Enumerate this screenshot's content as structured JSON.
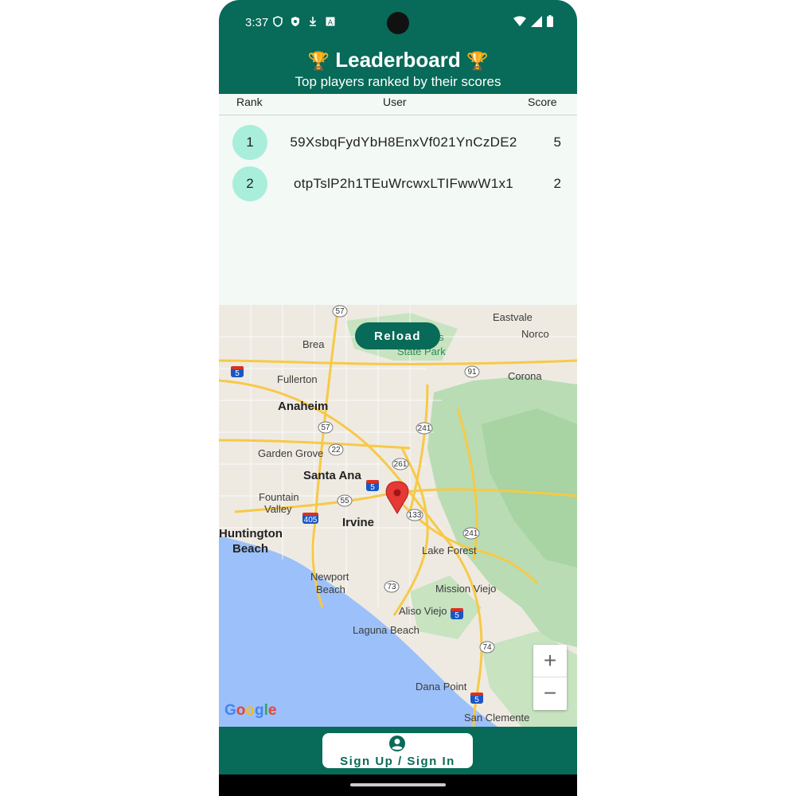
{
  "status_bar": {
    "time": "3:37"
  },
  "header": {
    "trophy_left": "🏆",
    "title": "Leaderboard",
    "trophy_right": "🏆",
    "subtitle": "Top players ranked by their scores"
  },
  "table": {
    "columns": {
      "rank": "Rank",
      "user": "User",
      "score": "Score"
    },
    "rows": [
      {
        "rank": "1",
        "user": "59XsbqFydYbH8EnxVf021YnCzDE2",
        "score": "5"
      },
      {
        "rank": "2",
        "user": "otpTslP2h1TEuWrcwxLTIFwwW1x1",
        "score": "2"
      }
    ]
  },
  "map": {
    "reload_label": "Reload",
    "zoom_in": "+",
    "zoom_out": "−",
    "attribution": "Google",
    "labels": {
      "eastvale": "Eastvale",
      "norco": "Norco",
      "brea": "Brea",
      "corona": "Corona",
      "fullerton": "Fullerton",
      "anaheim": "Anaheim",
      "garden_grove": "Garden Grove",
      "santa_ana": "Santa Ana",
      "fountain_valley_1": "Fountain",
      "fountain_valley_2": "Valley",
      "irvine": "Irvine",
      "huntington_1": "Huntington",
      "huntington_2": "Beach",
      "lake_forest": "Lake Forest",
      "newport_1": "Newport",
      "newport_2": "Beach",
      "mission_viejo": "Mission Viejo",
      "aliso_viejo": "Aliso Viejo",
      "laguna_beach": "Laguna Beach",
      "dana_point": "Dana Point",
      "san_clemente": "San Clemente",
      "park_1": "Hills",
      "park_2": "State Park"
    },
    "shields": [
      "57",
      "5",
      "91",
      "241",
      "57",
      "22",
      "261",
      "5",
      "55",
      "405",
      "133",
      "241",
      "73",
      "5",
      "74",
      "5"
    ],
    "marker_icon": "map-pin-icon"
  },
  "bottom": {
    "signin_label": "Sign Up / Sign In",
    "icon": "account-circle-icon"
  },
  "colors": {
    "primary": "#086a58",
    "badge": "#a8eedb",
    "background": "#f3f9f5",
    "marker": "#e53935"
  }
}
